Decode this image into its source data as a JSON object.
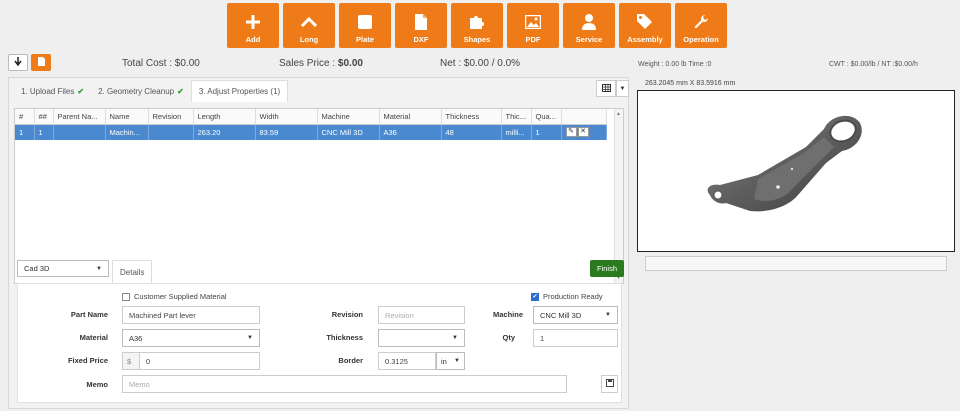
{
  "toolbar": {
    "buttons": [
      {
        "label": "Add",
        "icon": "plus-icon"
      },
      {
        "label": "Long",
        "icon": "chevron-up-icon"
      },
      {
        "label": "Plate",
        "icon": "square-icon"
      },
      {
        "label": "DXF",
        "icon": "file-icon"
      },
      {
        "label": "Shapes",
        "icon": "puzzle-icon"
      },
      {
        "label": "PDF",
        "icon": "image-icon"
      },
      {
        "label": "Service",
        "icon": "user-icon"
      },
      {
        "label": "Assembly",
        "icon": "tags-icon"
      },
      {
        "label": "Operation",
        "icon": "wrench-icon"
      }
    ],
    "accent": "#ef7b18"
  },
  "summary": {
    "total_cost": "Total Cost : $0.00",
    "sales_price_label": "Sales Price :",
    "sales_price_value": "$0.00",
    "net": "Net : $0.00 / 0.0%",
    "weight": "Weight : 0.00 lb Time :0",
    "cwt": "CWT : $0.00/lb / NT :$0.00/h"
  },
  "steps": [
    {
      "label": "1. Upload Files",
      "done": true
    },
    {
      "label": "2. Geometry Cleanup",
      "done": true
    },
    {
      "label": "3. Adjust Properties (1)",
      "done": false
    }
  ],
  "grid": {
    "columns": [
      "#",
      "##",
      "Parent Na...",
      "Name",
      "Revision",
      "Length",
      "Width",
      "Machine",
      "Material",
      "Thickness",
      "Thic...",
      "Qua...",
      ""
    ],
    "rows": [
      [
        "1",
        "1",
        "",
        "Machin...",
        "",
        "263.20",
        "83.59",
        "CNC Mill 3D",
        "A36",
        "48",
        "milli...",
        "1",
        ""
      ]
    ],
    "selected_color": "#4a89cf"
  },
  "bottom": {
    "import_type": "Cad 3D",
    "details_tab": "Details",
    "finish_label": "Finish"
  },
  "form": {
    "customer_supplied_label": "Customer Supplied Material",
    "production_ready_label": "Production Ready",
    "part_name_label": "Part Name",
    "part_name_value": "Machined Part lever",
    "revision_label": "Revision",
    "revision_placeholder": "Revision",
    "machine_label": "Machine",
    "machine_value": "CNC Mill 3D",
    "material_label": "Material",
    "material_value": "A36",
    "thickness_label": "Thickness",
    "thickness_value": "",
    "qty_label": "Qty",
    "qty_value": "1",
    "fixed_price_label": "Fixed Price",
    "currency": "$",
    "fixed_price_value": "0",
    "border_label": "Border",
    "border_value": "0.3125",
    "border_unit": "in",
    "memo_label": "Memo",
    "memo_placeholder": "Memo"
  },
  "viewer": {
    "dimensions": "263.2045 mm X 83.5916 mm"
  }
}
